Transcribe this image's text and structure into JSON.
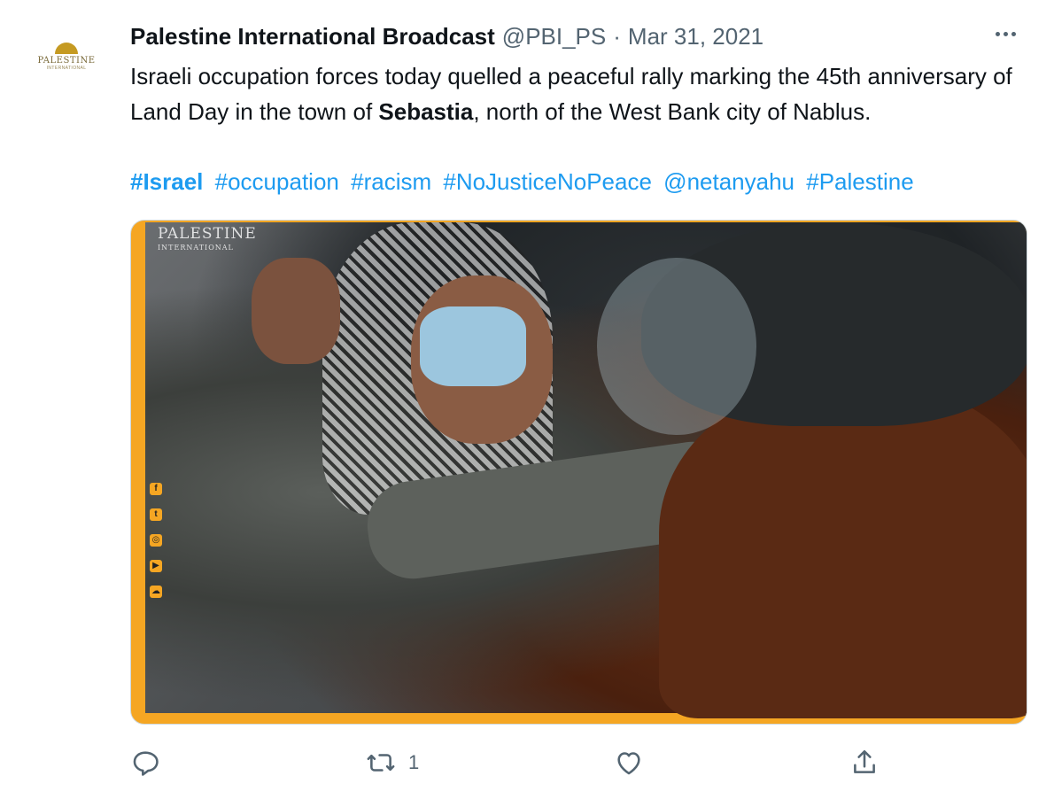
{
  "account": {
    "name": "Palestine International Broadcast",
    "handle": "@PBI_PS",
    "separator": "·",
    "date": "Mar 31, 2021",
    "avatar_logo": "PALESTINE",
    "avatar_sub": "INTERNATIONAL"
  },
  "tweet": {
    "text_before_bold": "Israeli occupation forces today quelled a peaceful rally marking the 45th anniversary of Land Day in the town of ",
    "bold_word": "Sebastia",
    "text_after_bold": ", north of the West Bank city of Nablus.",
    "tags": [
      "#Israel",
      "#occupation",
      "#racism",
      "#NoJusticeNoPeace",
      "@netanyahu",
      "#Palestine"
    ]
  },
  "media": {
    "watermark_title": "PALESTINE",
    "watermark_sub": "INTERNATIONAL",
    "social_icons": [
      "facebook-icon",
      "twitter-icon",
      "instagram-icon",
      "youtube-icon",
      "soundcloud-icon"
    ],
    "accent_color": "#f5a623"
  },
  "actions": {
    "reply_count": "",
    "retweet_count": "1",
    "like_count": "",
    "icons": [
      "reply-icon",
      "retweet-icon",
      "like-icon",
      "share-icon"
    ]
  },
  "colors": {
    "link": "#1d9bf0",
    "secondary_text": "#536471",
    "primary_text": "#0f1419"
  }
}
